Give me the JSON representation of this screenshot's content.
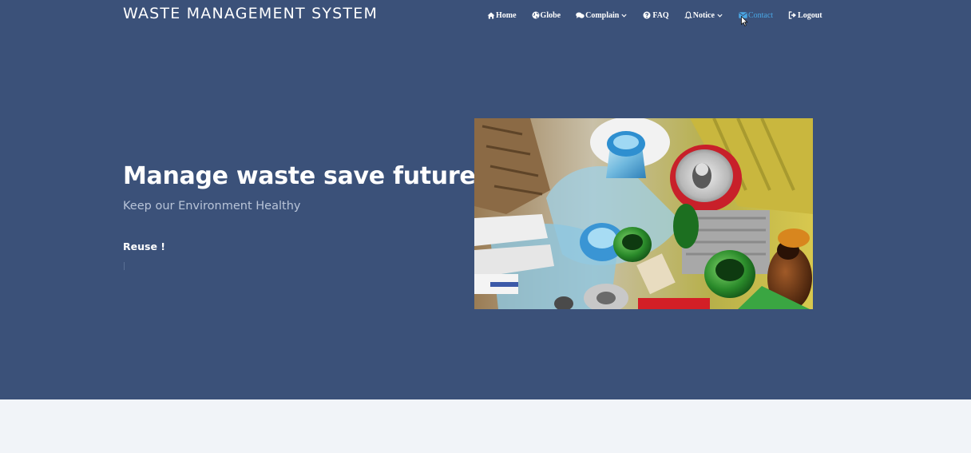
{
  "header": {
    "brand": "WASTE MANAGEMENT SYSTEM"
  },
  "nav": {
    "items": [
      {
        "label": "Home",
        "icon": "home-icon"
      },
      {
        "label": "Globe",
        "icon": "globe-icon"
      },
      {
        "label": "Complain",
        "icon": "chat-icon",
        "dropdown": true
      },
      {
        "label": "FAQ",
        "icon": "question-icon"
      },
      {
        "label": "Notice",
        "icon": "bell-icon",
        "dropdown": true
      },
      {
        "label": "Contact",
        "icon": "envelope-icon",
        "active": true
      },
      {
        "label": "Logout",
        "icon": "logout-icon"
      }
    ]
  },
  "hero": {
    "title": "Manage waste save future",
    "subtitle": "Keep our Environment Healthy",
    "typed_text": "Reuse !",
    "image_icon": "recyclables-photo"
  },
  "colors": {
    "hero_bg": "#3b5179",
    "page_bg": "#f1f4f8",
    "active_link": "#4aa8e6",
    "subtitle": "#b8c4d8"
  }
}
